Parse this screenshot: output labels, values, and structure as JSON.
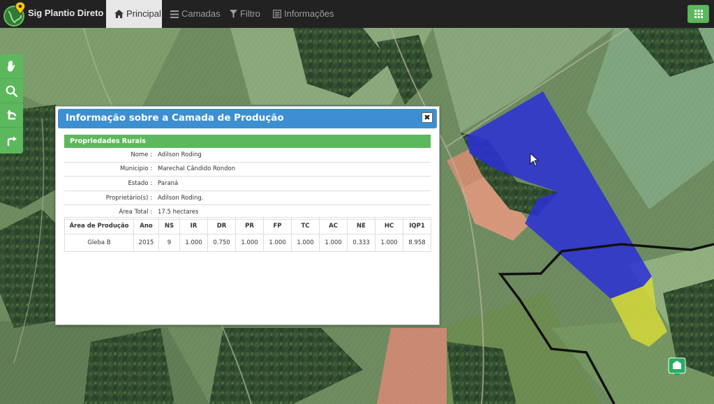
{
  "app": {
    "title": "Sig Plantio Direto"
  },
  "nav": {
    "items": [
      {
        "label": "Principal",
        "icon": "home-icon",
        "active": true
      },
      {
        "label": "Camadas",
        "icon": "list-icon",
        "active": false
      },
      {
        "label": "Filtro",
        "icon": "filter-icon",
        "active": false
      },
      {
        "label": "Informações",
        "icon": "list-alt-icon",
        "active": false
      }
    ],
    "apps_icon": "grid-icon"
  },
  "tools": [
    {
      "name": "pan-tool",
      "icon": "hand-icon"
    },
    {
      "name": "zoom-tool",
      "icon": "search-icon"
    },
    {
      "name": "undo-tool",
      "icon": "undo-icon"
    },
    {
      "name": "redo-tool",
      "icon": "redo-icon"
    }
  ],
  "popup": {
    "title": "Informação sobre a Camada de Produção",
    "close_label": "✖",
    "section": "Propriedades Rurais",
    "properties": [
      {
        "label": "Nome :",
        "value": "Adilson Roding"
      },
      {
        "label": "Municipio :",
        "value": "Marechal Cândido Rondon"
      },
      {
        "label": "Estado :",
        "value": "Paraná"
      },
      {
        "label": "Proprietário(s) :",
        "value": "Adilson Roding."
      },
      {
        "label": "Área Total :",
        "value": "17.5 hectares"
      }
    ],
    "table": {
      "headers": [
        "Área de Produção",
        "Ano",
        "NS",
        "IR",
        "DR",
        "PR",
        "FP",
        "TC",
        "AC",
        "NE",
        "HC",
        "IQP1"
      ],
      "rows": [
        [
          "Gleba B",
          "2015",
          "9",
          "1.000",
          "0.750",
          "1.000",
          "1.000",
          "1.000",
          "1.000",
          "0.333",
          "1.000",
          "8.958"
        ]
      ]
    }
  },
  "colors": {
    "navbar": "#222222",
    "accent_green": "#5cb85c",
    "popup_header": "#3d8fd1",
    "polygon_blue": "#2b2fd6",
    "polygon_yellow": "#d4d93a"
  }
}
